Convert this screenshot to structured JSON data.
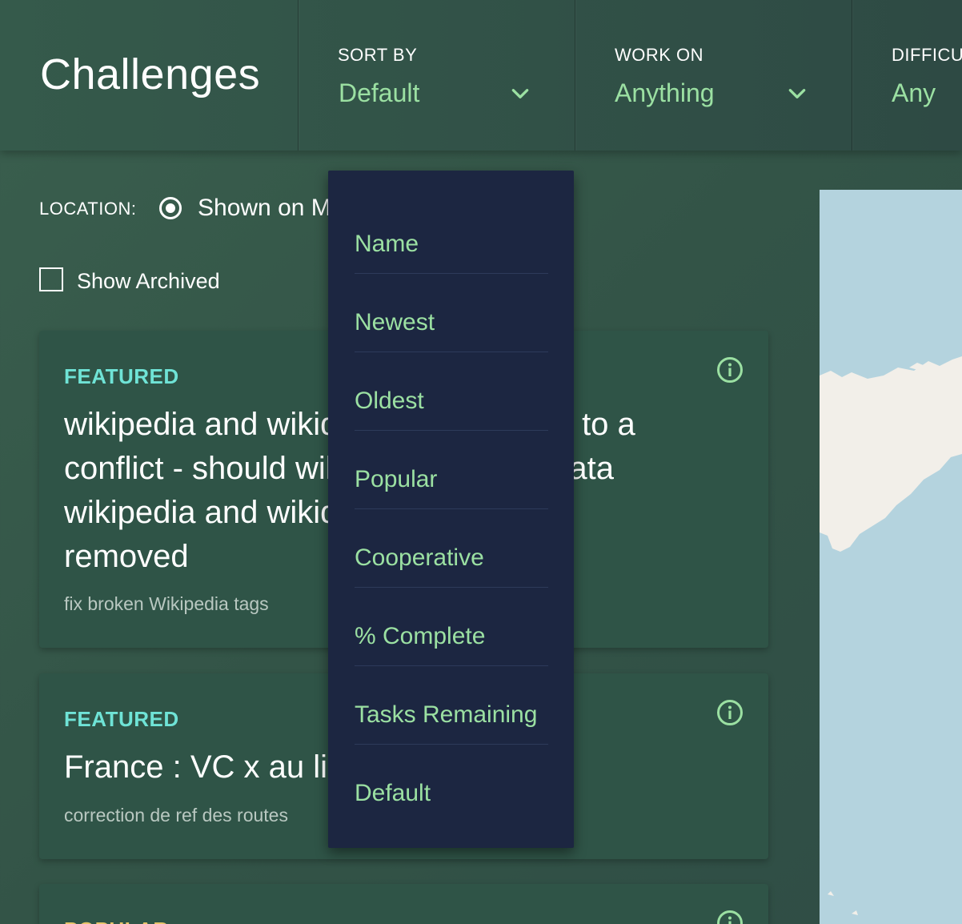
{
  "header": {
    "title": "Challenges",
    "filters": [
      {
        "label": "SORT BY",
        "value": "Default"
      },
      {
        "label": "WORK ON",
        "value": "Anything"
      },
      {
        "label": "DIFFICU",
        "value": "Any"
      }
    ]
  },
  "location": {
    "label": "LOCATION:",
    "option_label": "Shown on M"
  },
  "show_archived": {
    "label": "Show Archived",
    "checked": false
  },
  "cards": [
    {
      "tag": "FEATURED",
      "title": "wikipedia and wikidata tags pointing to a conflict - should wikipedia and wikidata tags be removed",
      "title_lines": [
        "wikipedia and wikidata tags pointing to a",
        "conflict - should wikipedia and wikidata",
        "wikipedia and wikidata tags be",
        "removed"
      ],
      "description": "fix broken Wikipedia tags"
    },
    {
      "tag": "FEATURED",
      "title": "France : VC x au lieu de",
      "description": "correction de ref des routes"
    },
    {
      "tag": "POPULAR",
      "title": "",
      "description": ""
    }
  ],
  "sort_menu": {
    "items": [
      "Name",
      "Newest",
      "Oldest",
      "Popular",
      "Cooperative",
      "% Complete",
      "Tasks Remaining",
      "Default"
    ]
  },
  "colors": {
    "accent_green": "#9be0a2",
    "featured_teal": "#6fe3d6",
    "popular_gold": "#e8c56a",
    "dropdown_bg": "#1c2641",
    "map_water": "#b4d3de"
  }
}
